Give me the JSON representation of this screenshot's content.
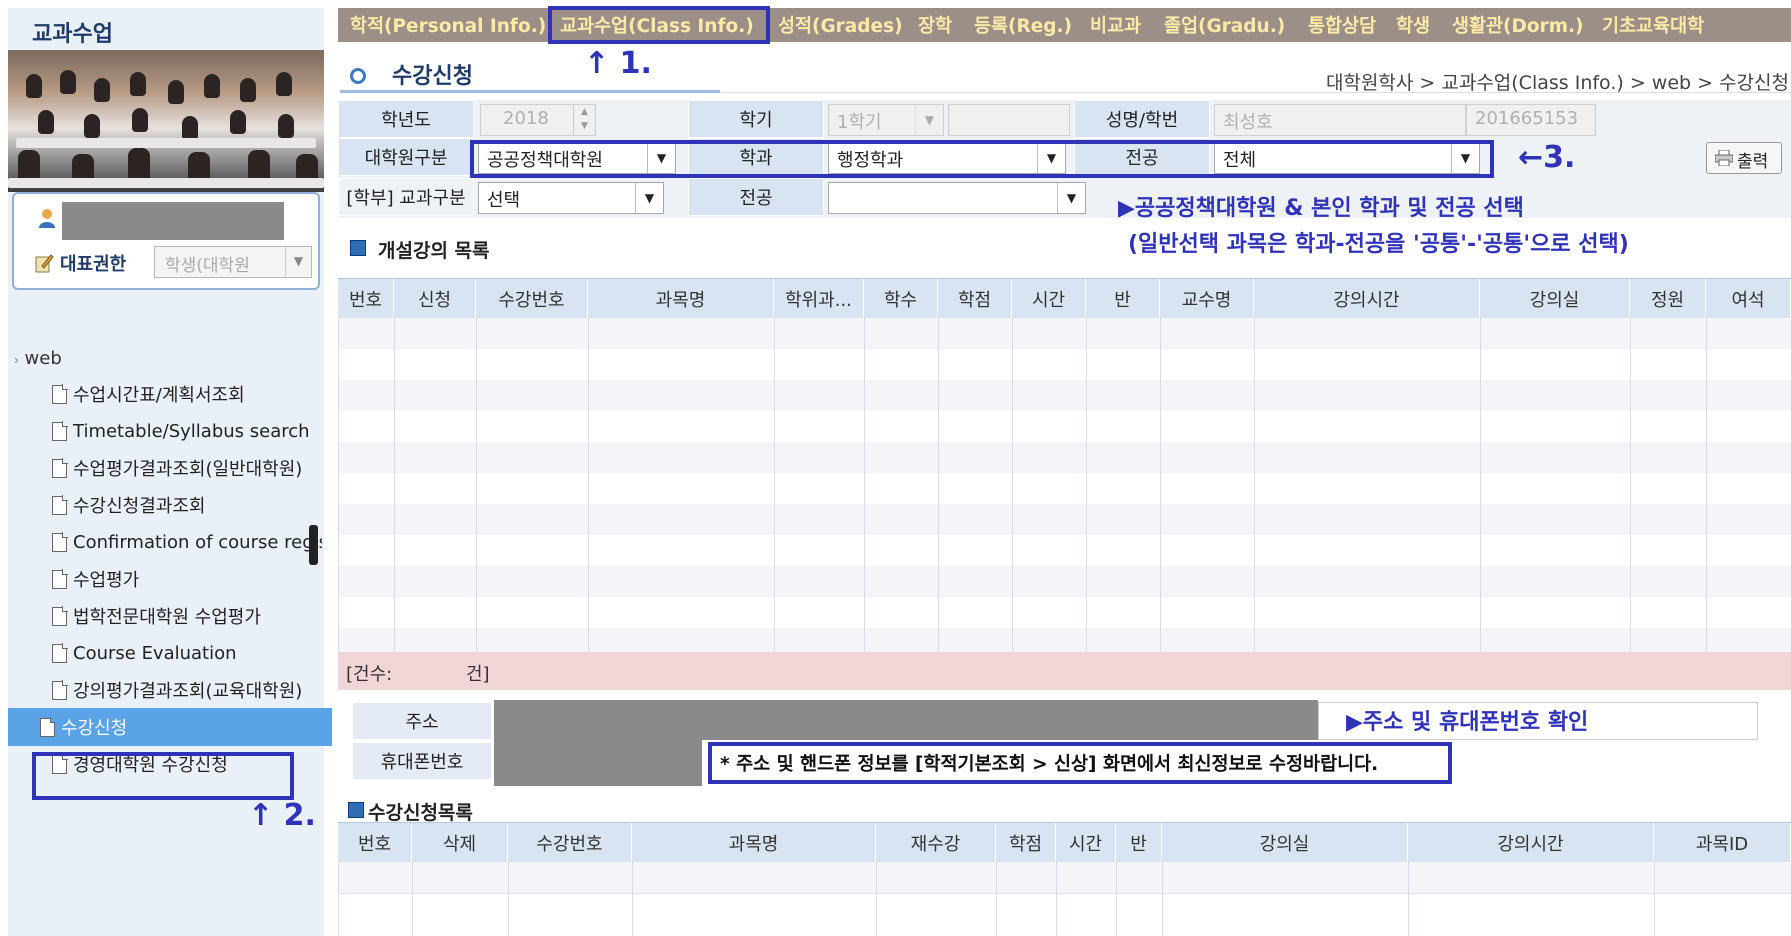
{
  "sidebar": {
    "title": "교과수업",
    "user_name": "",
    "auth_label": "대표권한",
    "auth_select": "학생(대학원",
    "tree_root": "web",
    "items": [
      {
        "label": "수업시간표/계획서조회"
      },
      {
        "label": "Timetable/Syllabus search"
      },
      {
        "label": "수업평가결과조회(일반대학원)"
      },
      {
        "label": "수강신청결과조회"
      },
      {
        "label": "Confirmation of course registration"
      },
      {
        "label": "수업평가"
      },
      {
        "label": "법학전문대학원 수업평가"
      },
      {
        "label": "Course Evaluation"
      },
      {
        "label": "강의평가결과조회(교육대학원)"
      },
      {
        "label": "수강신청"
      },
      {
        "label": "경영대학원 수강신청"
      }
    ]
  },
  "topmenu": [
    "학적(Personal Info.)",
    "교과수업(Class Info.)",
    "성적(Grades)",
    "장학",
    "등록(Reg.)",
    "비교과",
    "졸업(Gradu.)",
    "통합상담",
    "학생",
    "생활관(Dorm.)",
    "기초교육대학"
  ],
  "page": {
    "title": "수강신청",
    "breadcrumb": "대학원학사 > 교과수업(Class Info.) > web > 수강신청"
  },
  "form": {
    "year_label": "학년도",
    "year_value": "2018",
    "semester_label": "학기",
    "semester_value": "1학기",
    "name_label": "성명/학번",
    "name_value": "최성호",
    "student_id": "201665153",
    "grad_label": "대학원구분",
    "grad_value": "공공정책대학원",
    "dept_label": "학과",
    "dept_value": "행정학과",
    "major_label": "전공",
    "major_value": "전체",
    "print_label": "출력",
    "course_type_label": "[학부] 교과구분",
    "course_type_value": "선택",
    "major2_label": "전공",
    "major2_value": ""
  },
  "annotations": {
    "step1": "↑ 1.",
    "step2": "↑ 2.",
    "step3": "←3.",
    "note1": "▶공공정책대학원 & 본인 학과 및 전공 선택",
    "note2": "(일반선택 과목은 학과-전공을 '공통'-'공통'으로 선택)",
    "note3": "▶주소 및 휴대폰번호 확인",
    "note4": "* 주소 및 핸드폰 정보를 [학적기본조회 > 신상] 화면에서 최신정보로 수정바랍니다."
  },
  "open_courses": {
    "title": "개설강의 목록",
    "columns": [
      "번호",
      "신청",
      "수강번호",
      "과목명",
      "학위과...",
      "학수",
      "학점",
      "시간",
      "반",
      "교수명",
      "강의시간",
      "강의실",
      "정원",
      "여석"
    ],
    "count_prefix": "[건수:",
    "count_suffix": "건]"
  },
  "contact": {
    "address_label": "주소",
    "phone_label": "휴대폰번호"
  },
  "registered": {
    "title": "수강신청목록",
    "columns": [
      "번호",
      "삭제",
      "수강번호",
      "과목명",
      "재수강",
      "학점",
      "시간",
      "반",
      "강의실",
      "강의시간",
      "과목ID"
    ]
  },
  "colors": {
    "menu_bg": "#9c8f87",
    "menu_text": "#fbe9a8",
    "header_cell": "#d8e4f2",
    "annotation": "#2f33b8",
    "active_item": "#5aa3e6",
    "count_bar": "#f2d5d7"
  }
}
